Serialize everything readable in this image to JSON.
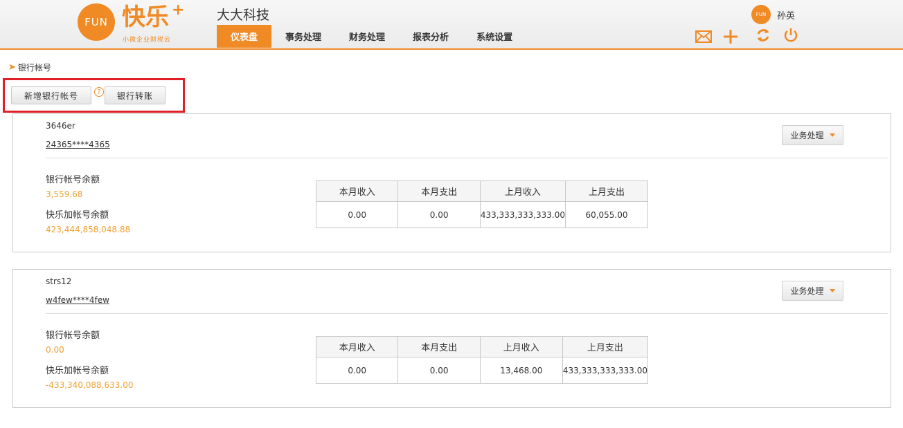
{
  "header": {
    "logo_mark": "FUN",
    "logo_text": "快乐",
    "logo_plus": "+",
    "logo_sub": "小微企业财税云",
    "company": "大大科技",
    "nav": [
      {
        "label": "仪表盘",
        "active": true
      },
      {
        "label": "事务处理",
        "active": false
      },
      {
        "label": "财务处理",
        "active": false
      },
      {
        "label": "报表分析",
        "active": false
      },
      {
        "label": "系统设置",
        "active": false
      }
    ],
    "avatar_text": "FUN",
    "username": "孙英",
    "tools": [
      "mail-icon",
      "plus-icon",
      "refresh-icon",
      "power-icon"
    ]
  },
  "breadcrumb": "银行帐号",
  "toolbar": {
    "add_label": "新增银行帐号",
    "help": "?",
    "transfer_label": "银行转账"
  },
  "accounts": [
    {
      "name": "3646er",
      "number": "24365****4365",
      "action": "业务处理",
      "bank_balance_label": "银行帐号余额",
      "bank_balance": "3,559.68",
      "kuaile_balance_label": "快乐加帐号余额",
      "kuaile_balance": "423,444,858,048.88",
      "headers": [
        "本月收入",
        "本月支出",
        "上月收入",
        "上月支出"
      ],
      "values": [
        "0.00",
        "0.00",
        "433,333,333,333.00",
        "60,055.00"
      ]
    },
    {
      "name": "strs12",
      "number": "w4few****4few",
      "action": "业务处理",
      "bank_balance_label": "银行帐号余额",
      "bank_balance": "0.00",
      "kuaile_balance_label": "快乐加帐号余额",
      "kuaile_balance": "-433,340,088,633.00",
      "headers": [
        "本月收入",
        "本月支出",
        "上月收入",
        "上月支出"
      ],
      "values": [
        "0.00",
        "0.00",
        "13,468.00",
        "433,333,333,333.00"
      ]
    }
  ],
  "colors": {
    "accent": "#f08a24",
    "highlight": "#e01f26",
    "value": "#f0a030"
  }
}
